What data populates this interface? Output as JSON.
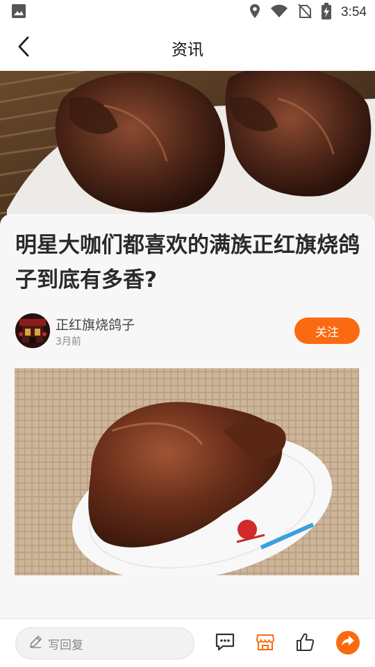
{
  "status_bar": {
    "time": "3:54",
    "icons": [
      "image-icon",
      "location-icon",
      "wifi-icon",
      "no-sim-icon",
      "battery-charging-icon"
    ]
  },
  "header": {
    "title": "资讯",
    "back_icon": "chevron-left-icon"
  },
  "article": {
    "title": "明星大咖们都喜欢的满族正红旗烧鸽子到底有多香?",
    "author": {
      "name": "正红旗烧鸽子",
      "time": "3月前"
    },
    "follow_label": "关注"
  },
  "bottom_bar": {
    "reply_placeholder": "写回复",
    "icons": [
      "comment-icon",
      "shop-icon",
      "like-icon",
      "share-icon"
    ]
  },
  "colors": {
    "accent": "#fb6a10",
    "background": "#f5f5f5",
    "title_text": "#2a2a2a"
  }
}
